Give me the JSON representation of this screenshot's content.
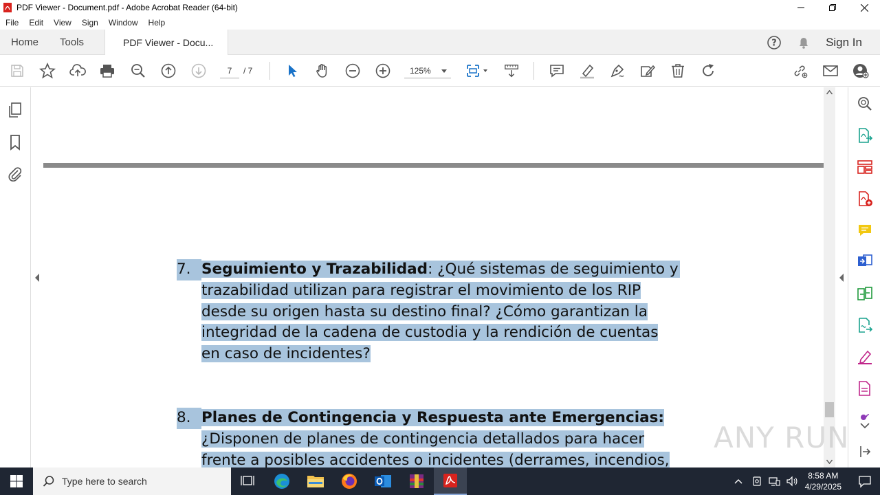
{
  "window": {
    "title": "PDF Viewer - Document.pdf - Adobe Acrobat Reader (64-bit)"
  },
  "menu": [
    "File",
    "Edit",
    "View",
    "Sign",
    "Window",
    "Help"
  ],
  "tabs": {
    "home": "Home",
    "tools": "Tools",
    "document": "PDF Viewer - Docu..."
  },
  "header": {
    "sign_in": "Sign In"
  },
  "toolbar": {
    "current_page": "7",
    "total_pages": "/ 7",
    "zoom": "125%"
  },
  "document": {
    "item7": {
      "number": "7.",
      "title": "Seguimiento y Trazabilidad",
      "lines": [
        ": ¿Qué sistemas de seguimiento y",
        "trazabilidad utilizan para registrar el movimiento de los RIP",
        "desde su origen hasta su destino final? ¿Cómo garantizan la",
        "integridad de la cadena de custodia y la rendición de cuentas",
        "en caso de incidentes?"
      ]
    },
    "item8": {
      "number": "8.",
      "title": "Planes de Contingencia y Respuesta ante Emergencias:",
      "lines": [
        "¿Disponen de planes de contingencia detallados para hacer",
        "frente a posibles accidentes o incidentes (derrames, incendios,"
      ]
    }
  },
  "watermark": "ANY RUN",
  "taskbar": {
    "search_placeholder": "Type here to search",
    "time": "8:58 AM",
    "date": "4/29/2025"
  },
  "colors": {
    "highlight": "#a8c4dd",
    "acrobat_red": "#d8231e",
    "taskbar": "#1f2633"
  }
}
